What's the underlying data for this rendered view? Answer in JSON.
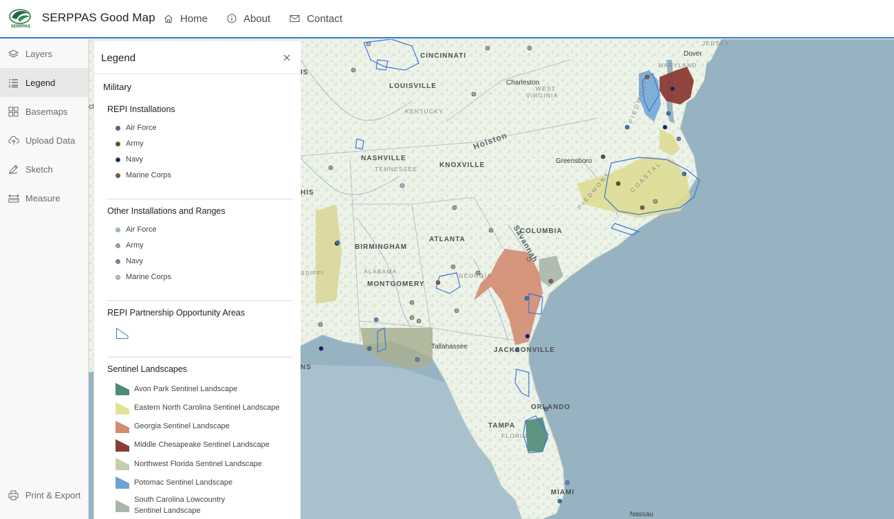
{
  "header": {
    "logo_text": "SERPPAS",
    "title": "SERPPAS Good Map",
    "nav": [
      {
        "label": "Home",
        "icon": "home-icon"
      },
      {
        "label": "About",
        "icon": "info-icon"
      },
      {
        "label": "Contact",
        "icon": "mail-icon"
      }
    ]
  },
  "sidebar": {
    "items": [
      {
        "label": "Layers",
        "icon": "layers-icon",
        "active": false
      },
      {
        "label": "Legend",
        "icon": "legend-icon",
        "active": true
      },
      {
        "label": "Basemaps",
        "icon": "basemap-icon",
        "active": false
      },
      {
        "label": "Upload Data",
        "icon": "upload-icon",
        "active": false
      },
      {
        "label": "Sketch",
        "icon": "sketch-icon",
        "active": false
      },
      {
        "label": "Measure",
        "icon": "measure-icon",
        "active": false
      }
    ],
    "print_export": {
      "label": "Print & Export",
      "icon": "print-icon"
    }
  },
  "legend": {
    "title": "Legend",
    "group": "Military",
    "repi_installations": {
      "title": "REPI Installations",
      "items": [
        {
          "label": "Air Force",
          "color": "#3b73b9"
        },
        {
          "label": "Army",
          "color": "#4d5a23"
        },
        {
          "label": "Navy",
          "color": "#0d1a8c"
        },
        {
          "label": "Marine Corps",
          "color": "#8a5a44"
        }
      ]
    },
    "other_installations": {
      "title": "Other Installations and Ranges",
      "items": [
        {
          "label": "Air Force",
          "color": "#9db9dd"
        },
        {
          "label": "Army",
          "color": "#a5a877"
        },
        {
          "label": "Navy",
          "color": "#6d7fc0"
        },
        {
          "label": "Marine Corps",
          "color": "#d3b9a6"
        }
      ]
    },
    "repi_areas": {
      "title": "REPI Partnership Opportunity Areas"
    },
    "sentinel": {
      "title": "Sentinel Landscapes",
      "items": [
        {
          "label": "Avon Park Sentinel Landscape",
          "color": "#4e8a78"
        },
        {
          "label": "Eastern North Carolina Sentinel Landscape",
          "color": "#e3e29a"
        },
        {
          "label": "Georgia Sentinel Landscape",
          "color": "#d38c71"
        },
        {
          "label": "Middle Chesapeake Sentinel Landscape",
          "color": "#8b3b35"
        },
        {
          "label": "Northwest Florida Sentinel Landscape",
          "color": "#c5cfac"
        },
        {
          "label": "Potomac Sentinel Landscape",
          "color": "#6da3d4"
        },
        {
          "label": "South Carolina Lowcountry Sentinel Landscape",
          "color": "#a8b6ab"
        }
      ]
    }
  },
  "map": {
    "labels": {
      "cincinnati": "CINCINNATI",
      "louisville": "LOUISVILLE",
      "kentucky": "KENTUCKY",
      "charleston": "Charleston",
      "west": "WEST",
      "virginia": "VIRGINIA",
      "holston": "Holston",
      "nashville": "NASHVILLE",
      "tennessee": "TENNESSEE",
      "knoxville": "KNOXVILLE",
      "greensboro": "Greensboro",
      "piedmont_nc": "PIEDMONT",
      "coastal": "COASTAL",
      "piedmont_va": "PIEDMONT",
      "maryland": "MARYLAND",
      "dover": "Dover",
      "jersey": "JERSEY",
      "birmingham": "BIRMINGHAM",
      "atlanta": "ATLANTA",
      "columbia": "COLUMBIA",
      "savannah": "Savannah",
      "alabama": "ALABAMA",
      "montgomery": "MONTGOMERY",
      "georgia": "GEORGIA",
      "tallahassee": "Tallahassee",
      "jacksonville": "JACKSONVILLE",
      "orlando": "ORLANDO",
      "tampa": "TAMPA",
      "florida": "FLORIDA",
      "miami": "MIAMI",
      "nassau": "Nassau",
      "his": "HIS",
      "ssippi": "SSIPPI",
      "ns": "NS",
      "is": "IS",
      "ct": "ct"
    }
  }
}
